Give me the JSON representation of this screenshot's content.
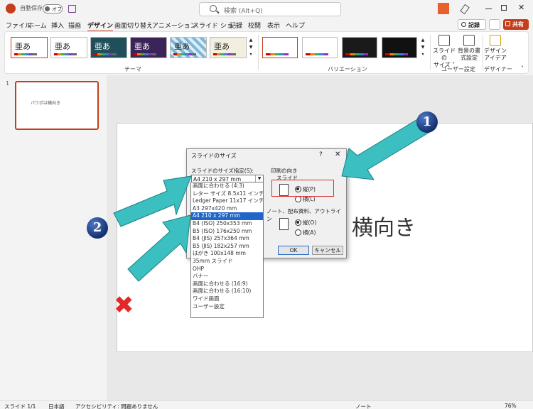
{
  "titlebar": {
    "autosave_label": "自動保存",
    "autosave_state": "オフ",
    "search_placeholder": "検索 (Alt+Q)"
  },
  "tabs": [
    "ファイル",
    "ホーム",
    "挿入",
    "描画",
    "デザイン",
    "画面切り替え",
    "アニメーション",
    "スライド ショー",
    "記録",
    "校閲",
    "表示",
    "ヘルプ"
  ],
  "active_tab": "デザイン",
  "ribbon_right": {
    "record_label": "記録",
    "share_label": "共有"
  },
  "ribbon": {
    "theme_sample": "亜あ",
    "themes_group_label": "テーマ",
    "variations_group_label": "バリエーション",
    "slide_size_label": "スライドの\nサイズ",
    "slide_size_label_1": "スライドの",
    "slide_size_label_2": "サイズ ˅",
    "format_bg_label_1": "背景の書",
    "format_bg_label_2": "式設定",
    "customize_group_label": "ユーザー設定",
    "designer_label_1": "デザイン",
    "designer_label_2": "アイデア",
    "designer_group_label": "デザイナー"
  },
  "thumbnail": {
    "number": "1",
    "title": "パワポは横向き"
  },
  "slide": {
    "text": "横向き"
  },
  "dialog": {
    "title": "スライドのサイズ",
    "help": "?",
    "close": "✕",
    "size_label": "スライドのサイズ指定(S):",
    "size_value": "A4 210 x 297 mm",
    "orientation_label": "印刷の向き",
    "slide_label": "スライド",
    "portrait": "縦(P)",
    "landscape": "横(L)",
    "notes_label": "ノート、配布資料、アウトライン",
    "notes_portrait": "縦(O)",
    "notes_landscape": "横(A)",
    "ok": "OK",
    "cancel": "キャンセル"
  },
  "size_options": [
    "画面に合わせる (4:3)",
    "レター サイズ 8.5x11 インチ",
    "Ledger Paper 11x17 インチ",
    "A3 297x420 mm",
    "A4 210 x 297 mm",
    "B4 (ISO) 250x353 mm",
    "B5 (ISO) 176x250 mm",
    "B4 (JIS) 257x364 mm",
    "B5 (JIS) 182x257 mm",
    "はがき 100x148 mm",
    "35mm スライド",
    "OHP",
    "バナー",
    "画面に合わせる (16:9)",
    "画面に合わせる (16:10)",
    "ワイド画面",
    "ユーザー設定"
  ],
  "selected_option_index": 4,
  "annotations": {
    "badge1": "1",
    "badge2": "2",
    "cross": "✖"
  },
  "statusbar": {
    "slide_count": "スライド 1/1",
    "language": "日本語",
    "accessibility": "アクセシビリティ: 問題ありません",
    "notes": "ノート",
    "zoom": "76%"
  },
  "colors": {
    "accent": "#c43e1c",
    "arrow": "#3bbfc0",
    "highlight": "#1f66c8",
    "red": "#d83030"
  }
}
